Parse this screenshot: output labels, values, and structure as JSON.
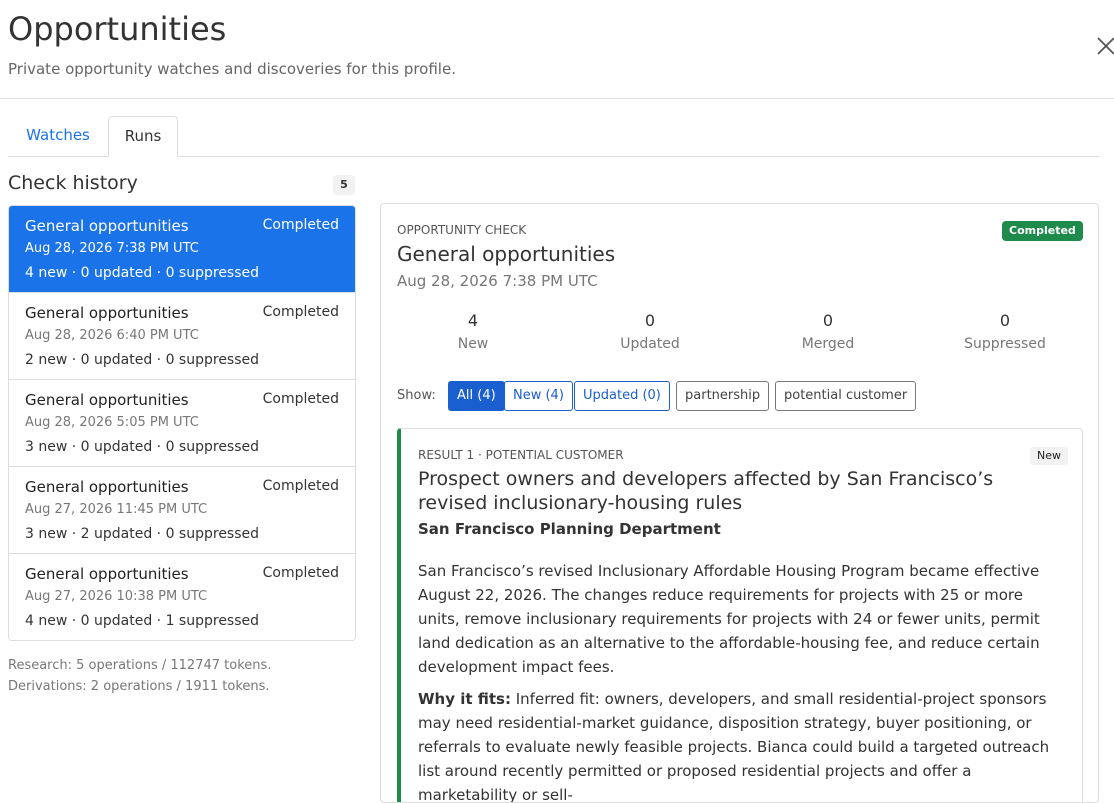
{
  "header": {
    "title": "Opportunities",
    "subtitle": "Private opportunity watches and discoveries for this profile."
  },
  "tabs": [
    {
      "label": "Watches",
      "active": false
    },
    {
      "label": "Runs",
      "active": true
    }
  ],
  "history": {
    "title": "Check history",
    "count": "5",
    "runs": [
      {
        "name": "General opportunities",
        "status": "Completed",
        "date": "Aug 28, 2026 7:38 PM UTC",
        "stats": "4 new · 0 updated · 0 suppressed",
        "active": true
      },
      {
        "name": "General opportunities",
        "status": "Completed",
        "date": "Aug 28, 2026 6:40 PM UTC",
        "stats": "2 new · 0 updated · 0 suppressed",
        "active": false
      },
      {
        "name": "General opportunities",
        "status": "Completed",
        "date": "Aug 28, 2026 5:05 PM UTC",
        "stats": "3 new · 0 updated · 0 suppressed",
        "active": false
      },
      {
        "name": "General opportunities",
        "status": "Completed",
        "date": "Aug 27, 2026 11:45 PM UTC",
        "stats": "3 new · 2 updated · 0 suppressed",
        "active": false
      },
      {
        "name": "General opportunities",
        "status": "Completed",
        "date": "Aug 27, 2026 10:38 PM UTC",
        "stats": "4 new · 0 updated · 1 suppressed",
        "active": false
      }
    ],
    "usage": [
      "Research: 5 operations / 112747 tokens.",
      "Derivations: 2 operations / 1911 tokens."
    ]
  },
  "detail": {
    "kicker": "OPPORTUNITY CHECK",
    "badge": "Completed",
    "title": "General opportunities",
    "date": "Aug 28, 2026 7:38 PM UTC",
    "stats": [
      {
        "value": "4",
        "label": "New"
      },
      {
        "value": "0",
        "label": "Updated"
      },
      {
        "value": "0",
        "label": "Merged"
      },
      {
        "value": "0",
        "label": "Suppressed"
      }
    ],
    "show_label": "Show:",
    "filters": [
      {
        "label": "All (4)",
        "selected": true
      },
      {
        "label": "New (4)",
        "selected": false
      },
      {
        "label": "Updated (0)",
        "selected": false
      },
      {
        "label": "partnership",
        "selected": false
      },
      {
        "label": "potential customer",
        "selected": false
      }
    ],
    "result": {
      "kicker": "RESULT 1 · POTENTIAL CUSTOMER",
      "badge": "New",
      "title": "Prospect owners and developers affected by San Francisco’s revised inclusionary-housing rules",
      "source": "San Francisco Planning Department",
      "body": "San Francisco’s revised Inclusionary Affordable Housing Program became effective August 22, 2026. The changes reduce requirements for projects with 25 or more units, remove inclusionary requirements for projects with 24 or fewer units, permit land dedication as an alternative to the affordable-housing fee, and reduce certain development impact fees.",
      "why_label": "Why it fits:",
      "why_text": " Inferred fit: owners, developers, and small residential-project sponsors may need residential-market guidance, disposition strategy, buyer positioning, or referrals to evaluate newly feasible projects. Bianca could build a targeted outreach list around recently permitted or proposed residential projects and offer a marketability or sell-"
    }
  },
  "colors": {
    "accent": "#1a73e8",
    "success": "#1e8a4c",
    "filter_blue": "#1a5fd0"
  }
}
